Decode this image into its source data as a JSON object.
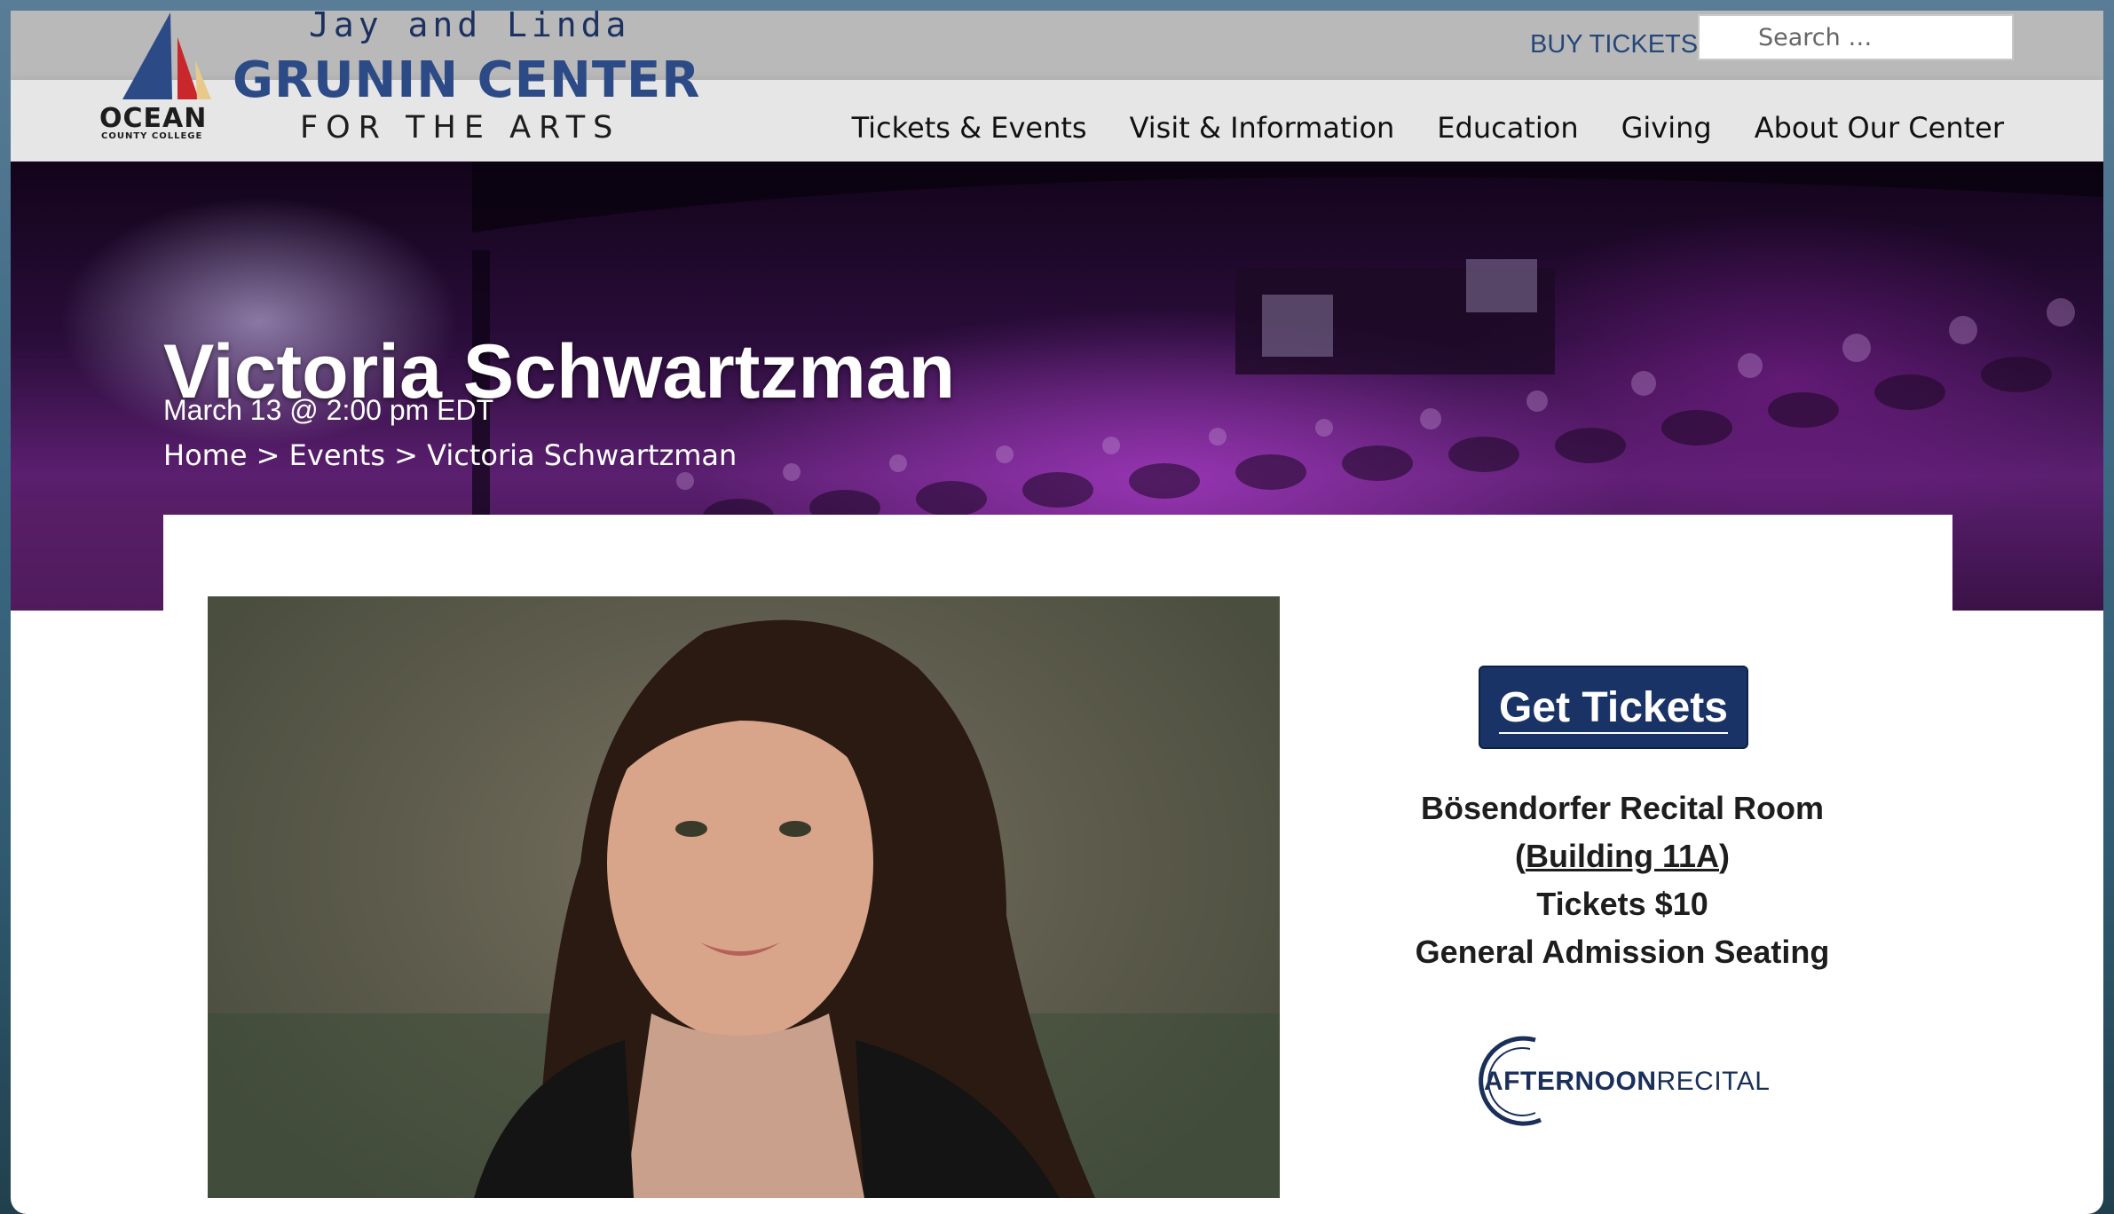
{
  "header": {
    "logo": {
      "line1": "Jay and Linda",
      "line2": "GRUNIN CENTER",
      "line3": "FOR THE ARTS",
      "college_name": "OCEAN",
      "college_sub": "COUNTY COLLEGE"
    },
    "buy_tickets": "BUY TICKETS",
    "search_placeholder": "Search …",
    "nav": [
      "Tickets & Events",
      "Visit & Information",
      "Education",
      "Giving",
      "About Our Center"
    ]
  },
  "hero": {
    "title": "Victoria Schwartzman",
    "date": "March 13 @ 2:00 pm EDT",
    "breadcrumb": [
      "Home",
      "Events",
      "Victoria Schwartzman"
    ],
    "separator": ">"
  },
  "event": {
    "get_tickets": "Get Tickets",
    "venue": "Bösendorfer Recital Room",
    "building_open": "(",
    "building": "Building 11A",
    "building_close": ")",
    "price": "Tickets $10",
    "seating": "General Admission Seating",
    "series_logo_bold": "AFTERNOON",
    "series_logo_light": "RECITAL"
  },
  "colors": {
    "brand_navy": "#1a3366",
    "header_gray": "#b9b9b9",
    "nav_gray": "#e6e6e6"
  }
}
